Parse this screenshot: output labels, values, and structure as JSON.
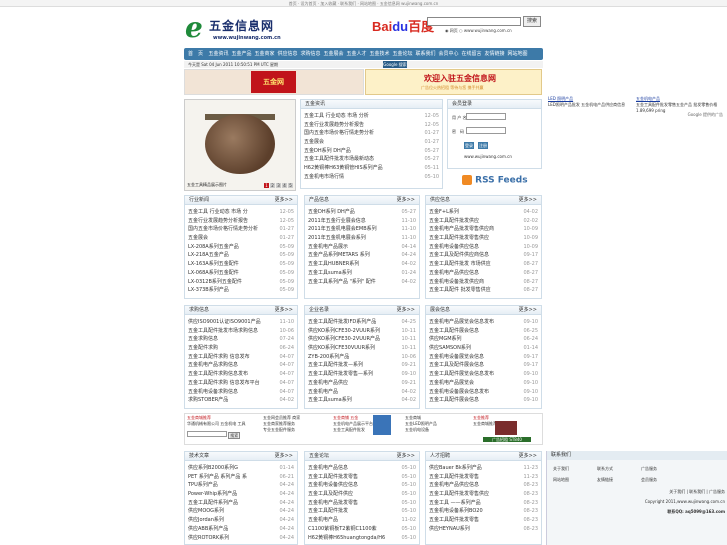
{
  "topbar": {
    "text": "首页 · 设为首页 · 加入收藏 · 联系我们 · 网站地图 · 五金信息网 wujinwang.com.cn"
  },
  "logo": {
    "mark": "e",
    "name": "五金信息网",
    "url": "www.wujinwang.com.cn"
  },
  "baidu": {
    "text1": "Bai",
    "paw": "du",
    "text2": "百度",
    "button": "搜索",
    "radio1": "网页",
    "radio2": "www.wujinwang.com.cn"
  },
  "nav": [
    "首　页",
    "五金资讯",
    "五金产品",
    "五金商家",
    "供应信息",
    "求购信息",
    "五金展会",
    "五金人才",
    "五金技术",
    "五金论坛",
    "联系我们",
    "会员中心",
    "在线留言",
    "友情链接",
    "网站地图"
  ],
  "datebar": {
    "date": "今天是 Sat 04 Jun 2011 10:50:51 PM UTC 星期",
    "google": "Google 搜索",
    "links": [
      "搜索",
      "资讯",
      "产品",
      "供应",
      "求购",
      "企业"
    ]
  },
  "banner1": {
    "badge": "五金网"
  },
  "banner2": {
    "title": "欢迎入驻五金信息网",
    "sub": "广告位火热招租 等待与您 携手共赢"
  },
  "photo": {
    "caption": "五金工具精品展示图片",
    "pages": [
      "1",
      "2",
      "3",
      "4",
      "5"
    ]
  },
  "news": {
    "title": "五金资讯",
    "items": [
      {
        "t": "五金工具 行业动态 市场 分析",
        "d": "12-05"
      },
      {
        "t": "五金行业发展趋势分析报告",
        "d": "12-05"
      },
      {
        "t": "国内五金市场价格行情走势分析",
        "d": "01-27"
      },
      {
        "t": "五金展会",
        "d": "01-27"
      },
      {
        "t": "五金DH系列 DH产品",
        "d": "05-27"
      },
      {
        "t": "五金工具配件批发市场最新动态",
        "d": "05-27"
      },
      {
        "t": "H62黄铜棒H63黄铜管HIS系列产品",
        "d": "05-11"
      },
      {
        "t": "五金机电市场行情",
        "d": "05-10"
      }
    ]
  },
  "login": {
    "title": "会员登录",
    "user": "用 户 名",
    "pass": "密　码",
    "login": "登录",
    "reg": "注册",
    "url": "www.wujinwang.com.cn"
  },
  "rss": {
    "text": "RSS Feeds"
  },
  "sections": [
    {
      "title": "行业新闻",
      "more": "更多>>",
      "items": [
        {
          "t": "五金工具 行业动态 市场 分",
          "d": "12-05"
        },
        {
          "t": "五金行业发展趋势分析报告",
          "d": "12-05"
        },
        {
          "t": "国内五金市场价格行情走势分析",
          "d": "01-27"
        },
        {
          "t": "五金展会",
          "d": "01-27"
        },
        {
          "t": "LX-208A系列五金产品",
          "d": "05-09"
        },
        {
          "t": "LX-218A五金产品",
          "d": "05-09"
        },
        {
          "t": "LX-163A系列五金配件",
          "d": "05-09"
        },
        {
          "t": "LX-068A系列五金配件",
          "d": "05-09"
        },
        {
          "t": "LX-0312B系列五金配件",
          "d": "05-09"
        },
        {
          "t": "LX-373B系列产品",
          "d": "05-09"
        }
      ]
    },
    {
      "title": "产品信息",
      "more": "更多>>",
      "items": [
        {
          "t": "五金DH系列 DH产品",
          "d": "05-27"
        },
        {
          "t": "2011年五金行业展会信息",
          "d": "11-10"
        },
        {
          "t": "2011年五金机电展会EMB系列",
          "d": "11-10"
        },
        {
          "t": "2011年五金机电展会系列",
          "d": "11-10"
        },
        {
          "t": "五金机电产品展示",
          "d": "04-14"
        },
        {
          "t": "五金产品系列METARS 系列",
          "d": "04-24"
        },
        {
          "t": "五金工具HUBNER系列",
          "d": "04-02"
        },
        {
          "t": "五金工具suma系列",
          "d": "01-24"
        },
        {
          "t": "五金工具系列产品 \"系列\" 配件",
          "d": "04-02"
        }
      ]
    },
    {
      "title": "供应信息",
      "more": "更多>>",
      "items": [
        {
          "t": "五金F+L系列",
          "d": "04-02"
        },
        {
          "t": "五金工具配件批发供应",
          "d": "02-02"
        },
        {
          "t": "五金机电产品批发零售供应商",
          "d": "10-09"
        },
        {
          "t": "五金工具配件批发零售供应",
          "d": "10-09"
        },
        {
          "t": "五金机电设备供应信息",
          "d": "10-09"
        },
        {
          "t": "五金工具及配件供应商信息",
          "d": "09-17"
        },
        {
          "t": "五金工具配件批发 市场供应",
          "d": "08-27"
        },
        {
          "t": "五金机电产品供应信息",
          "d": "08-27"
        },
        {
          "t": "五金机电设备批发供应商",
          "d": "08-27"
        },
        {
          "t": "五金工具配件 批发零售供应",
          "d": "08-27"
        }
      ]
    },
    {
      "title": "求购信息",
      "more": "更多>>",
      "items": [
        {
          "t": "供应ISO9001认证ISO9001产品",
          "d": "11-10"
        },
        {
          "t": "五金工具配件批发市场求购信息",
          "d": "10-06"
        },
        {
          "t": "五金求购信息",
          "d": "07-24"
        },
        {
          "t": "五金配件求购",
          "d": "06-24"
        },
        {
          "t": "五金工具配件求购 信息发布",
          "d": "04-07"
        },
        {
          "t": "五金机电产品求购信息",
          "d": "04-07"
        },
        {
          "t": "五金工具配件求购信息发布",
          "d": "04-07"
        },
        {
          "t": "五金工具配件求购 信息发布平台",
          "d": "04-07"
        },
        {
          "t": "五金机电设备求购信息",
          "d": "04-07"
        },
        {
          "t": "求购STOBER产品",
          "d": "04-02"
        }
      ]
    },
    {
      "title": "企业名录",
      "more": "更多>>",
      "items": [
        {
          "t": "五金工具配件批发IFD系列产品",
          "d": "04-25"
        },
        {
          "t": "供应KO系列CFE30-2VUUR系列",
          "d": "10-11"
        },
        {
          "t": "供应KO系列CFE30-2VUUR产品",
          "d": "10-11"
        },
        {
          "t": "供应KO系列CFE30VUUR系列",
          "d": "10-11"
        },
        {
          "t": "ZYB-200系列产品",
          "d": "10-06"
        },
        {
          "t": "五金工具配件批发—系列",
          "d": "09-21"
        },
        {
          "t": "五金工具配件批发零售—系列",
          "d": "09-10"
        },
        {
          "t": "五金机电产品供应",
          "d": "09-21"
        },
        {
          "t": "五金机电产品",
          "d": "04-02"
        },
        {
          "t": "五金工具suma系列",
          "d": "04-02"
        }
      ]
    },
    {
      "title": "展会信息",
      "more": "更多>>",
      "items": [
        {
          "t": "五金机电产品展览会信息发布",
          "d": "09-10"
        },
        {
          "t": "五金工具配件展会信息",
          "d": "06-25"
        },
        {
          "t": "供应MGM系列",
          "d": "06-24"
        },
        {
          "t": "供应SAMSON系列",
          "d": "01-14"
        },
        {
          "t": "五金机电设备展览会信息",
          "d": "09-17"
        },
        {
          "t": "五金工具及配件展会信息",
          "d": "09-17"
        },
        {
          "t": "五金工具配件展览会信息发布",
          "d": "09-10"
        },
        {
          "t": "五金机电产品展览会",
          "d": "09-10"
        },
        {
          "t": "五金机电设备展会信息发布",
          "d": "09-10"
        },
        {
          "t": "五金工具配件展会信息",
          "d": "09-10"
        }
      ]
    },
    {
      "title": "技术文章",
      "more": "更多>>",
      "items": [
        {
          "t": "供应系列B2000系列G",
          "d": "01-14"
        },
        {
          "t": "PET 系列产品 系列产品 系",
          "d": "06-21"
        },
        {
          "t": "TPU系列产品",
          "d": "04-24"
        },
        {
          "t": "Power-Whip系列产品",
          "d": "04-24"
        },
        {
          "t": "五金工具配件系列产品",
          "d": "04-24"
        },
        {
          "t": "供应MOOG系列",
          "d": "04-24"
        },
        {
          "t": "供应Jordan系列",
          "d": "04-24"
        },
        {
          "t": "供应ABB系列产品",
          "d": "04-24"
        },
        {
          "t": "供应ROTORK系列",
          "d": "04-24"
        }
      ]
    },
    {
      "title": "五金论坛",
      "more": "更多>>",
      "items": [
        {
          "t": "五金机电产品信息",
          "d": "05-10"
        },
        {
          "t": "五金工具配件批发零售",
          "d": "05-10"
        },
        {
          "t": "五金机电设备供应信息",
          "d": "05-10"
        },
        {
          "t": "五金工具及配件供应",
          "d": "05-10"
        },
        {
          "t": "五金机电产品批发零售",
          "d": "05-10"
        },
        {
          "t": "五金工具配件批发",
          "d": "05-10"
        },
        {
          "t": "五金机电产品",
          "d": "11-02"
        },
        {
          "t": "C1100紫铜板T2紫铜C1100紫",
          "d": "05-10"
        },
        {
          "t": "H62黄铜棒H65huangtongda/H6",
          "d": "05-10"
        }
      ]
    },
    {
      "title": "人才招聘",
      "more": "更多>>",
      "items": [
        {
          "t": "供应Bauer Bk系列产品",
          "d": "11-23"
        },
        {
          "t": "五金工具配件批发零售",
          "d": "11-23"
        },
        {
          "t": "五金机电产品供应信息",
          "d": "08-23"
        },
        {
          "t": "五金工具配件批发零售供应",
          "d": "08-23"
        },
        {
          "t": "五金工具 ——系列产品",
          "d": "08-23"
        },
        {
          "t": "五金机电设备系列BO20",
          "d": "08-23"
        },
        {
          "t": "五金工具配件批发零售",
          "d": "08-23"
        },
        {
          "t": "供应HEYNAU系列",
          "d": "08-23"
        }
      ]
    }
  ],
  "adsrow": {
    "c1": "五金商城推荐",
    "c1sub": "华通机械有限公司 五金机电 工具",
    "c1btn": "搜索",
    "c2": "五金网会员推荐 商家",
    "c2b": "五金商家推荐服务",
    "c2c": "专业五金配件服务",
    "c3": "五金商铺 五金",
    "c3b": "五金机电产品展示平台",
    "c3c": "五金工具配件批发",
    "c4": "五金商城",
    "c4b": "五金LED照明产品",
    "c4c": "五金机电设备",
    "c5": "五金推荐",
    "c5b": "五金商城推荐",
    "c6": "广告招租 ST840"
  },
  "adright": {
    "a1": "LED 照明产品",
    "a2": "LED照明产品批发 五金机电产品供应商信息",
    "a3": "五金机电产品",
    "a4": "五金工具配件批发零售五金产品 批发零售价格 1.89,699 pring",
    "google": "Google 提供的广告"
  },
  "right2": {
    "title": "联系我们",
    "items": [
      "关于我们",
      "联系方式",
      "广告服务",
      "网站地图",
      "友情链接",
      "会员服务",
      "投诉建议",
      "版权声明",
      "隐私政策",
      "帮助中心",
      "招聘信息",
      "网站导航"
    ],
    "f1": "关于我们 | 联系我们 | 广告服务",
    "f2": "Copyright 2011,www.wujinwang.com.cn",
    "f3": "联系QQ: aq5099@163.com"
  }
}
